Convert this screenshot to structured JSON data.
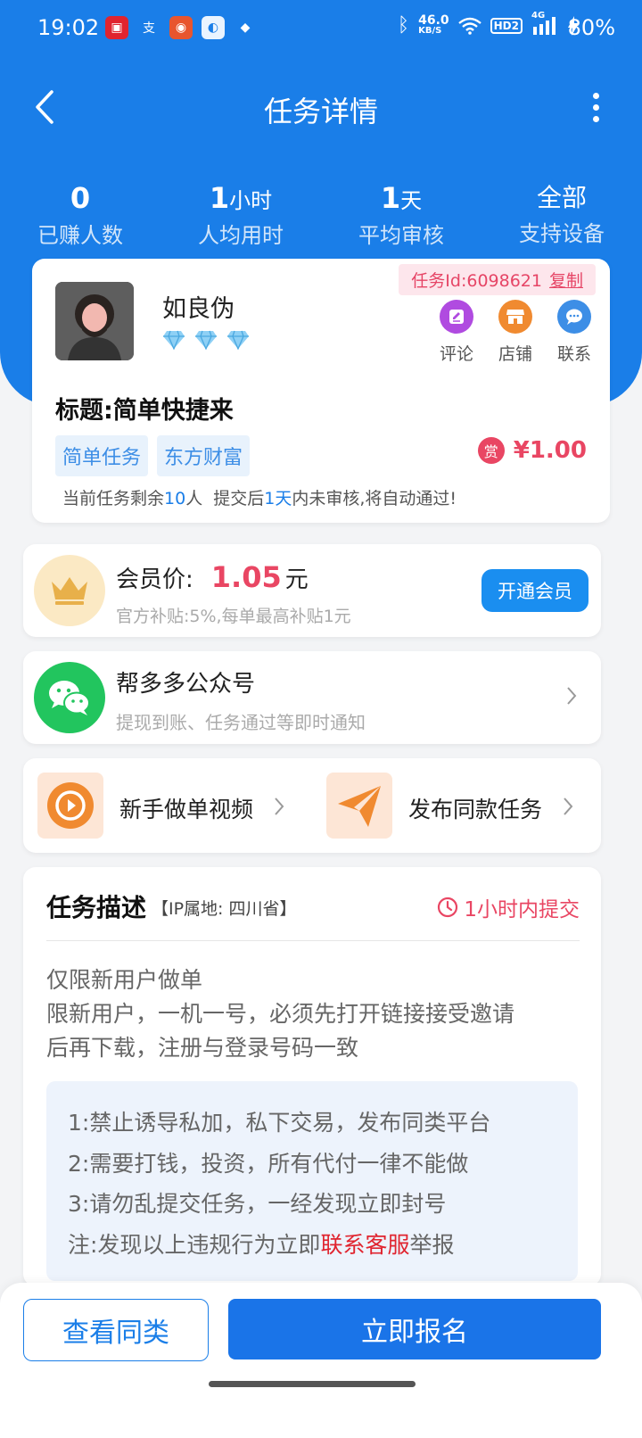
{
  "status_bar": {
    "time": "19:02",
    "net_speed_top": "46.0",
    "net_speed_bottom": "KB/S",
    "hd_label": "HD2",
    "signal_label": "4G",
    "battery": "80%"
  },
  "nav": {
    "title": "任务详情"
  },
  "stats": [
    {
      "value": "0",
      "unit": "",
      "label": "已赚人数"
    },
    {
      "value": "1",
      "unit": "小时",
      "label": "人均用时"
    },
    {
      "value": "1",
      "unit": "天",
      "label": "平均审核"
    },
    {
      "value": "全部",
      "unit": "",
      "label": "支持设备"
    }
  ],
  "task": {
    "id_label": "任务Id:6098621",
    "copy_label": "复制",
    "publisher_name": "如良伪",
    "diamond_count": 3,
    "actions": [
      {
        "label": "评论",
        "icon": "comment-icon",
        "color": "#b04be0"
      },
      {
        "label": "店铺",
        "icon": "store-icon",
        "color": "#f08a30"
      },
      {
        "label": "联系",
        "icon": "chat-icon",
        "color": "#3d8ee6"
      }
    ],
    "title": "标题:简单快捷来",
    "tags": [
      "简单任务",
      "东方财富"
    ],
    "reward_badge": "赏",
    "reward": "¥1.00",
    "note_prefix": "当前任务剩余",
    "note_remaining": "10",
    "note_mid": "人  提交后",
    "note_days": "1天",
    "note_suffix": "内未审核,将自动通过!"
  },
  "vip": {
    "label": "会员价:",
    "price": "1.05",
    "unit": "元",
    "subtitle": "官方补贴:5%,每单最高补贴1元",
    "button": "开通会员"
  },
  "wechat": {
    "title": "帮多多公众号",
    "subtitle": "提现到账、任务通过等即时通知"
  },
  "shortcuts": [
    {
      "label": "新手做单视频",
      "icon": "play-icon"
    },
    {
      "label": "发布同款任务",
      "icon": "send-icon"
    }
  ],
  "description": {
    "title": "任务描述",
    "ip": "【IP属地: 四川省】",
    "deadline": "1小时内提交",
    "lines": [
      "仅限新用户做单",
      "限新用户，一机一号，必须先打开链接接受邀请",
      "后再下载，注册与登录号码一致"
    ],
    "rules": [
      "1:禁止诱导私加，私下交易，发布同类平台",
      "2:需要打钱，投资，所有代付一律不能做",
      "3:请勿乱提交任务，一经发现立即封号"
    ],
    "rule4_prefix": "注:发现以上违规行为立即",
    "rule4_link": "联系客服",
    "rule4_suffix": "举报"
  },
  "bottom": {
    "similar": "查看同类",
    "signup": "立即报名"
  },
  "colors": {
    "primary": "#1a7ee8",
    "accent_red": "#e94663",
    "link_red": "#e0242f"
  }
}
